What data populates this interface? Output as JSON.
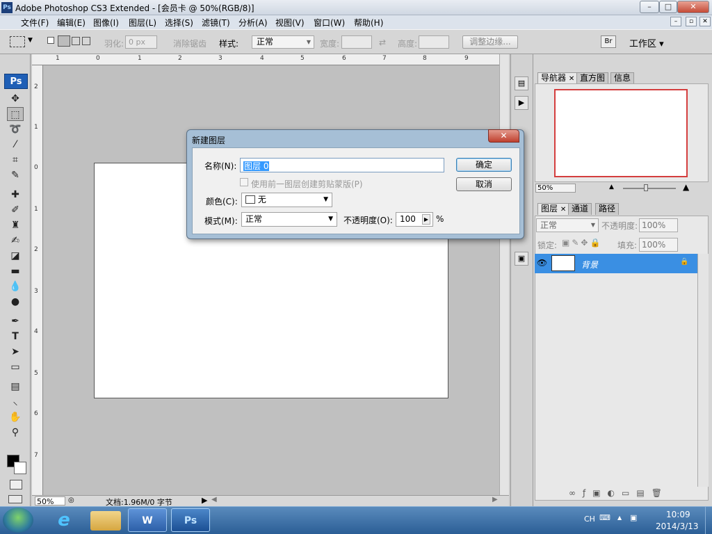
{
  "window": {
    "title": "Adobe Photoshop CS3 Extended - [会员卡 @ 50%(RGB/8)]",
    "app_icon": "Ps",
    "minimize": "–",
    "maximize": "□",
    "close": "✕"
  },
  "menu": [
    "文件(F)",
    "编辑(E)",
    "图像(I)",
    "图层(L)",
    "选择(S)",
    "滤镜(T)",
    "分析(A)",
    "视图(V)",
    "窗口(W)",
    "帮助(H)"
  ],
  "options": {
    "feather_label": "羽化:",
    "feather_value": "0 px",
    "antialias_label": "消除锯齿",
    "style_label": "样式:",
    "style_value": "正常",
    "width_label": "宽度:",
    "height_label": "高度:",
    "refine_button": "调整边缘...",
    "workspace_label": "工作区 ▾"
  },
  "toolbox": {
    "logo": "Ps",
    "tools": [
      "move-icon",
      "marquee-icon",
      "lasso-icon",
      "magic-wand-icon",
      "crop-icon",
      "slice-icon",
      "healing-icon",
      "brush-icon",
      "stamp-icon",
      "history-brush-icon",
      "eraser-icon",
      "gradient-icon",
      "blur-icon",
      "dodge-icon",
      "pen-icon",
      "type-icon",
      "path-select-icon",
      "shape-icon",
      "notes-icon",
      "eyedropper-icon",
      "hand-icon",
      "zoom-icon"
    ],
    "text_tool": "T"
  },
  "rulers": {
    "top": [
      "1",
      "0",
      "1",
      "2",
      "3",
      "4",
      "5",
      "6",
      "7",
      "8",
      "9"
    ],
    "left": [
      "2",
      "1",
      "0",
      "1",
      "2",
      "3",
      "4",
      "5",
      "6",
      "7"
    ]
  },
  "status": {
    "zoom": "50%",
    "doc_info": "文档:1.96M/0 字节"
  },
  "navigator": {
    "tabs": [
      "导航器",
      "直方图",
      "信息"
    ],
    "zoom": "50%"
  },
  "layers": {
    "tabs": [
      "图层",
      "通道",
      "路径"
    ],
    "blend_mode": "正常",
    "opacity_label": "不透明度:",
    "opacity_value": "100%",
    "lock_label": "锁定:",
    "fill_label": "填充:",
    "fill_value": "100%",
    "layer_name": "背景"
  },
  "dialog": {
    "title": "新建图层",
    "close": "✕",
    "name_label": "名称(N):",
    "name_value": "图层 0",
    "clip_label": "使用前一图层创建剪贴蒙版(P)",
    "color_label": "颜色(C):",
    "color_value": "无",
    "mode_label": "模式(M):",
    "mode_value": "正常",
    "opacity_label": "不透明度(O):",
    "opacity_value": "100",
    "percent": "%",
    "ok": "确定",
    "cancel": "取消"
  },
  "taskbar": {
    "ps_label": "Ps",
    "word_label": "W",
    "lang": "CH",
    "time": "10:09",
    "date": "2014/3/13"
  },
  "colors": {
    "title_bg": "#dce3ec",
    "dialog_frame": "#a6bfd6",
    "selection_blue": "#3399ff",
    "layer_highlight": "#3a8fe3",
    "navigator_box": "#d43e3e"
  }
}
